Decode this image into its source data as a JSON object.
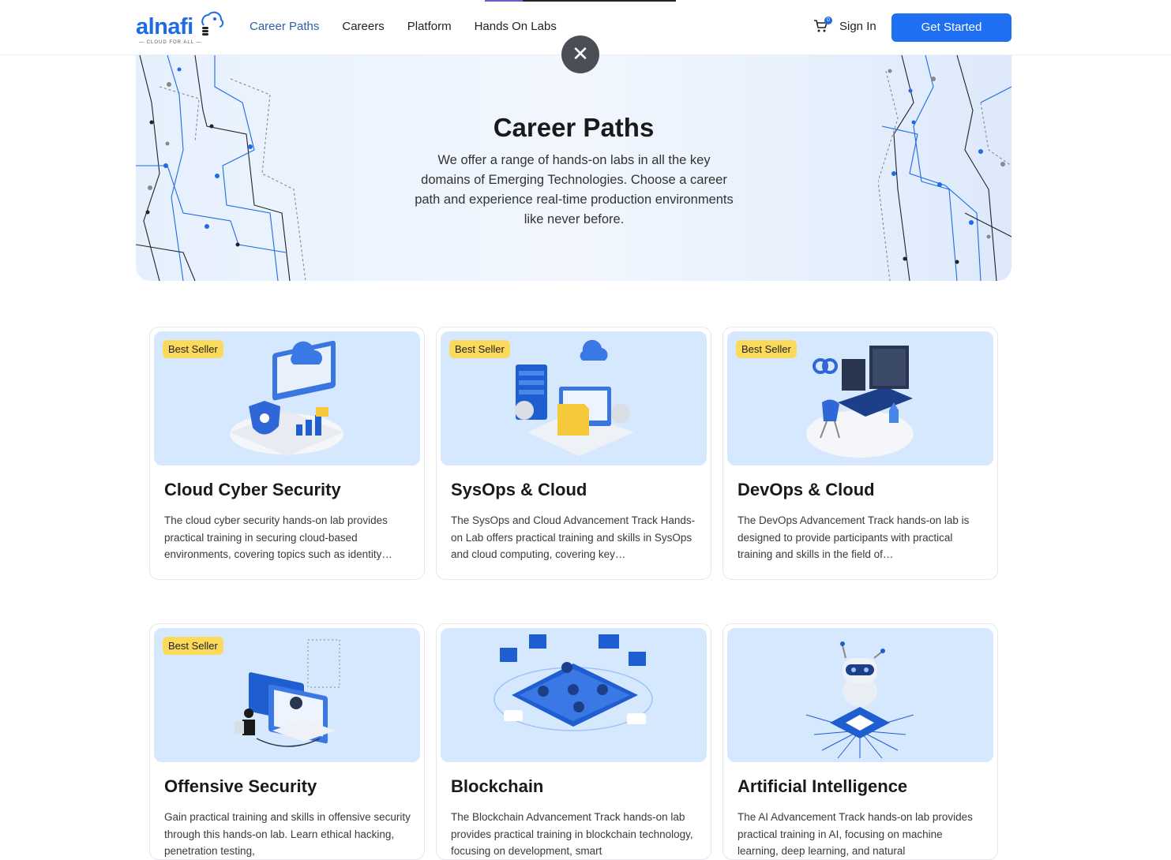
{
  "header": {
    "logo_text": "alnafi",
    "logo_tagline": "CLOUD FOR ALL",
    "nav": [
      "Career Paths",
      "Careers",
      "Platform",
      "Hands On Labs"
    ],
    "cart_count": "0",
    "sign_in": "Sign In",
    "get_started": "Get Started",
    "close_glyph": "✕"
  },
  "hero": {
    "title": "Career Paths",
    "description": "We offer a range of hands-on labs in all the key domains of Emerging Technologies. Choose a career path and experience real-time production environments like never before."
  },
  "cards": [
    {
      "badge": "Best Seller",
      "title": "Cloud Cyber Security",
      "description": "The cloud cyber security hands-on lab provides practical training in securing cloud-based environments, covering topics such as identity…"
    },
    {
      "badge": "Best Seller",
      "title": "SysOps & Cloud",
      "description": "The SysOps and Cloud Advancement Track Hands-on Lab offers practical training and skills in SysOps and cloud computing, covering key…"
    },
    {
      "badge": "Best Seller",
      "title": "DevOps & Cloud",
      "description": "The DevOps Advancement Track hands-on lab is designed to provide participants with practical training and skills in the field of…"
    },
    {
      "badge": "Best Seller",
      "title": "Offensive Security",
      "description": "Gain practical training and skills in offensive security through this hands-on lab. Learn ethical hacking, penetration testing,"
    },
    {
      "badge": "",
      "title": "Blockchain",
      "description": "The Blockchain Advancement Track hands-on lab provides practical training in blockchain technology, focusing on development, smart"
    },
    {
      "badge": "",
      "title": "Artificial Intelligence",
      "description": "The AI Advancement Track hands-on lab provides practical training in AI, focusing on machine learning, deep learning, and natural"
    }
  ],
  "colors": {
    "accent": "#1f6ff2",
    "badge": "#fbd95a",
    "card_image_bg": "#d6e8fd"
  }
}
